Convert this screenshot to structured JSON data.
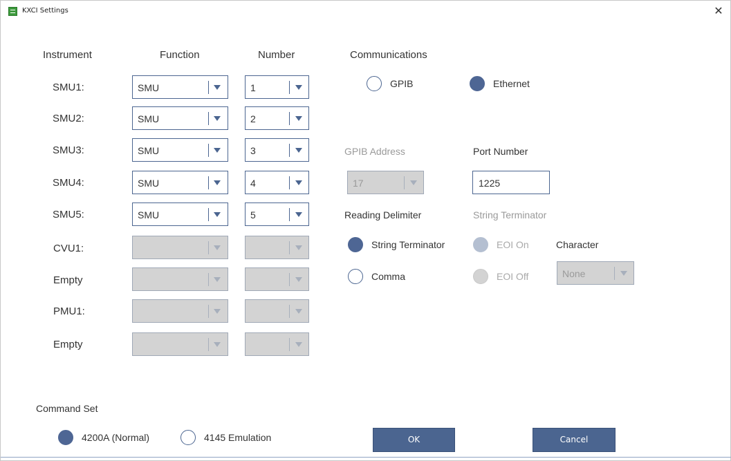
{
  "window": {
    "title": "KXCI Settings",
    "close_glyph": "✕",
    "icon": "app-grid-icon"
  },
  "instrument_table": {
    "headers": {
      "instrument": "Instrument",
      "function": "Function",
      "number": "Number"
    },
    "rows": [
      {
        "instrument": "SMU1:",
        "function": "SMU",
        "number": "1",
        "enabled": true
      },
      {
        "instrument": "SMU2:",
        "function": "SMU",
        "number": "2",
        "enabled": true
      },
      {
        "instrument": "SMU3:",
        "function": "SMU",
        "number": "3",
        "enabled": true
      },
      {
        "instrument": "SMU4:",
        "function": "SMU",
        "number": "4",
        "enabled": true
      },
      {
        "instrument": "SMU5:",
        "function": "SMU",
        "number": "5",
        "enabled": true
      },
      {
        "instrument": "CVU1:",
        "function": "",
        "number": "",
        "enabled": false
      },
      {
        "instrument": "Empty",
        "function": "",
        "number": "",
        "enabled": false
      },
      {
        "instrument": "PMU1:",
        "function": "",
        "number": "",
        "enabled": false
      },
      {
        "instrument": "Empty",
        "function": "",
        "number": "",
        "enabled": false
      }
    ]
  },
  "communications": {
    "label": "Communications",
    "options": [
      {
        "label": "GPIB",
        "checked": false
      },
      {
        "label": "Ethernet",
        "checked": true
      }
    ]
  },
  "gpib_address": {
    "label": "GPIB Address",
    "value": "17",
    "enabled": false
  },
  "port_number": {
    "label": "Port Number",
    "value": "1225"
  },
  "reading_delimiter": {
    "label": "Reading Delimiter",
    "options": [
      {
        "label": "String Terminator",
        "checked": true
      },
      {
        "label": "Comma",
        "checked": false
      }
    ]
  },
  "string_terminator": {
    "label": "String Terminator",
    "options": [
      {
        "label": "EOI On",
        "checked": true,
        "enabled": false
      },
      {
        "label": "EOI Off",
        "checked": false,
        "enabled": false
      }
    ],
    "character_label": "Character",
    "character_value": "None"
  },
  "command_set": {
    "label": "Command Set",
    "options": [
      {
        "label": "4200A (Normal)",
        "checked": true
      },
      {
        "label": "4145 Emulation",
        "checked": false
      }
    ]
  },
  "buttons": {
    "ok": "OK",
    "cancel": "Cancel"
  },
  "colors": {
    "accent": "#4b6590",
    "radio_fill": "#4e6694",
    "disabled_fill": "#d3d3d3"
  }
}
